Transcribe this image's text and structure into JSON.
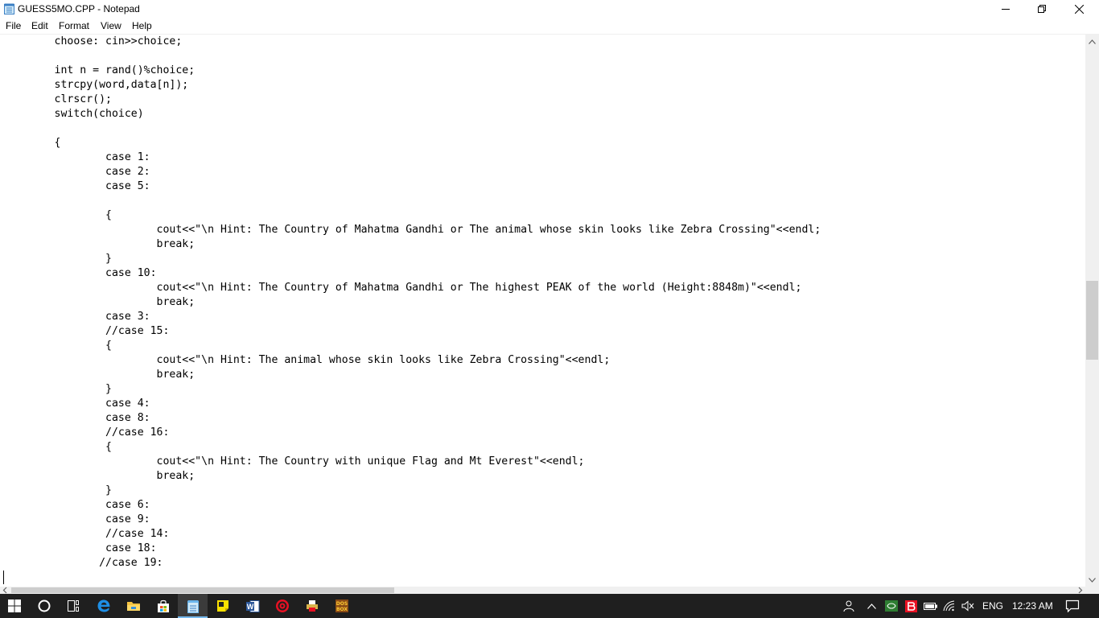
{
  "window": {
    "title": "GUESS5MO.CPP - Notepad"
  },
  "menu": [
    "File",
    "Edit",
    "Format",
    "View",
    "Help"
  ],
  "editor": {
    "lines": [
      "        choose: cin>>choice;",
      "",
      "        int n = rand()%choice;",
      "        strcpy(word,data[n]);",
      "        clrscr();",
      "        switch(choice)",
      "",
      "        {",
      "                case 1:",
      "                case 2:",
      "                case 5:",
      "",
      "                {",
      "                        cout<<\"\\n Hint: The Country of Mahatma Gandhi or The animal whose skin looks like Zebra Crossing\"<<endl;",
      "                        break;",
      "                }",
      "                case 10:",
      "                        cout<<\"\\n Hint: The Country of Mahatma Gandhi or The highest PEAK of the world (Height:8848m)\"<<endl;",
      "                        break;",
      "                case 3:",
      "                //case 15:",
      "                {",
      "                        cout<<\"\\n Hint: The animal whose skin looks like Zebra Crossing\"<<endl;",
      "                        break;",
      "                }",
      "                case 4:",
      "                case 8:",
      "                //case 16:",
      "                {",
      "                        cout<<\"\\n Hint: The Country with unique Flag and Mt Everest\"<<endl;",
      "                        break;",
      "                }",
      "                case 6:",
      "                case 9:",
      "                //case 14:",
      "                case 18:",
      "               //case 19:",
      ""
    ]
  },
  "taskbar": {
    "apps": [
      {
        "name": "start-button",
        "icon": "windows-logo-icon"
      },
      {
        "name": "search-button",
        "icon": "cortana-circle-icon"
      },
      {
        "name": "task-view-button",
        "icon": "task-view-icon"
      },
      {
        "name": "edge-app",
        "icon": "edge-icon"
      },
      {
        "name": "file-explorer-app",
        "icon": "folder-icon"
      },
      {
        "name": "store-app",
        "icon": "store-bag-icon"
      },
      {
        "name": "notepad-app",
        "icon": "notepad-icon"
      },
      {
        "name": "sticky-notes-app",
        "icon": "sticky-note-icon"
      },
      {
        "name": "word-app",
        "icon": "word-icon"
      },
      {
        "name": "red-app",
        "icon": "red-circle-icon"
      },
      {
        "name": "printer-app",
        "icon": "printer-icon"
      },
      {
        "name": "dosbox-app",
        "icon": "dosbox-icon"
      }
    ],
    "tray": {
      "language": "ENG",
      "time": "12:23 AM",
      "dosbox_label": "DOS BOX"
    }
  },
  "colors": {
    "taskbar": "#1f1f1f",
    "active_underline": "#76b9ed",
    "scroll_thumb": "#cdcdcd"
  }
}
